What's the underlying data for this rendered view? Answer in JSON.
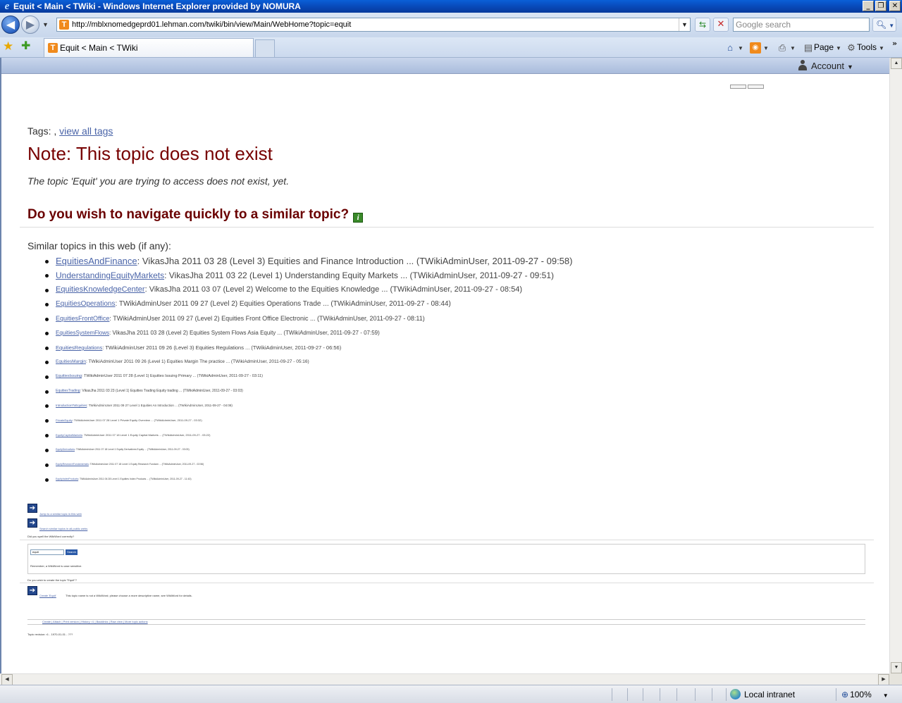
{
  "window": {
    "title": "Equit < Main < TWiki - Windows Internet Explorer provided by NOMURA",
    "ie_logo": "e",
    "minimize": "_",
    "restore": "❐",
    "close": "✕"
  },
  "address_bar": {
    "url": "http://mblxnomedgeprd01.lehman.com/twiki/bin/view/Main/WebHome?topic=equit",
    "favicon_letter": "T",
    "search_placeholder": "Google search"
  },
  "tabs": [
    {
      "label": "Equit < Main < TWiki"
    }
  ],
  "command_bar": {
    "page_label": "Page",
    "tools_label": "Tools"
  },
  "header": {
    "account_label": "Account"
  },
  "page": {
    "tags_prefix": "Tags: , ",
    "tags_link": "view all tags",
    "note_heading": "Note: This topic does not exist",
    "note_text": "The topic 'Equit' you are trying to access does not exist, yet.",
    "navigate_heading": "Do you wish to navigate quickly to a similar topic?",
    "similar_label": "Similar topics in this web (if any):",
    "similar_topics": [
      {
        "name": "EquitiesAndFinance",
        "summary": ": VikasJha 2011 03 28 (Level 3) Equities and Finance Introduction ... (TWikiAdminUser, 2011-09-27 - 09:58)"
      },
      {
        "name": "UnderstandingEquityMarkets",
        "summary": ": VikasJha 2011 03 22 (Level 1) Understanding Equity Markets ... (TWikiAdminUser, 2011-09-27 - 09:51)"
      },
      {
        "name": "EquitiesKnowledgeCenter",
        "summary": ": VikasJha 2011 03 07 (Level 2) Welcome to the Equities Knowledge ... (TWikiAdminUser, 2011-09-27 - 08:54)"
      },
      {
        "name": "EquitiesOperations",
        "summary": ": TWikiAdminUser 2011 09 27 (Level 2) Equities Operations Trade ... (TWikiAdminUser, 2011-09-27 - 08:44)"
      },
      {
        "name": "EquitiesFrontOffice",
        "summary": ": TWikiAdminUser 2011 09 27 (Level 2) Equities Front Office Electronic ... (TWikiAdminUser, 2011-09-27 - 08:11)"
      },
      {
        "name": "EquitiesSystemFlows",
        "summary": ": VikasJha 2011 03 28 (Level 2) Equities System Flows Asia Equity ... (TWikiAdminUser, 2011-09-27 - 07:59)"
      },
      {
        "name": "EquitiesRegulations",
        "summary": ": TWikiAdminUser 2011 09 26 (Level 3) Equities Regulations ... (TWikiAdminUser, 2011-09-27 - 06:56)"
      },
      {
        "name": "EquitiesMargin",
        "summary": ": TWikiAdminUser 2011 09 26 (Level 1) Equities Margin The practice ... (TWikiAdminUser, 2011-09-27 - 05:16)"
      },
      {
        "name": "EquitiesIssuing",
        "summary": ": TWikiAdminUser 2011 07 28 (Level 1) Equities Issuing Primary ... (TWikiAdminUser, 2011-09-27 - 03:11)"
      },
      {
        "name": "EquitiesTrading",
        "summary": ": VikasJha 2011 03 23 (Level 1) Equities Trading Equity trading ... (TWikiAdminUser, 2011-09-27 - 03:03)"
      },
      {
        "name": "IntroductionToEquities",
        "summary": ": TWikiAdminUser 2011 09 27 Level 1 Equities An Introduction ... (TWikiAdminUser, 2011-09-27 - 04:08)"
      },
      {
        "name": "PrivateEquity",
        "summary": ": TWikiAdminUser 2011 07 28 Level 1 Private Equity Overview ... (TWikiAdminUser, 2011-09-27 - 03:32)"
      },
      {
        "name": "EquityCapitalMarkets",
        "summary": ": TWikiAdminUser 2011 07 18 Level 1 Equity Capital Markets ... (TWikiAdminUser, 2011-09-27 - 03:22)"
      },
      {
        "name": "EquityDerivatives",
        "summary": ": TWikiAdminUser 2011 07 18 Level 1 Equity Derivatives Equity ... (TWikiAdminUser, 2011-09-27 - 03:03)"
      },
      {
        "name": "EquityResearchFundamentals",
        "summary": ": TWikiAdminUser 2011 07 18 Level 1 Equity Research Fundam ... (TWikiAdminUser, 2011-09-27 - 02:56)"
      },
      {
        "name": "EquityIndexProducts",
        "summary": ": TWikiAdminUser 2011 06 28 Level 1 Equities Index Products ... (TWikiAdminUser, 2011-09-27 - 11:43)"
      }
    ],
    "actions": {
      "search_similar": "Jump to a similar topic in this web",
      "search_all_webs": "Search similar topics in all public webs",
      "did_you_spell": "Did you spell the WikiWord correctly?",
      "search_value": "equit",
      "search_button": "Search",
      "search_hint": "Remember, a WikiWord is case sensitive.",
      "create_question": "Do you wish to create the topic \"Equit\"?",
      "create_link": "Create 'Equit'",
      "create_note": "This topic name is not a WikiWord; please choose a more descriptive name, see WikiWord for details."
    },
    "footer_links": "Create | Attach | Print version | History: r1 | Backlinks | Raw view | More topic actions",
    "revision": "Topic revision: r1 - 1970-01-01 - ???"
  },
  "status_bar": {
    "zone": "Local intranet",
    "zoom": "100%"
  }
}
